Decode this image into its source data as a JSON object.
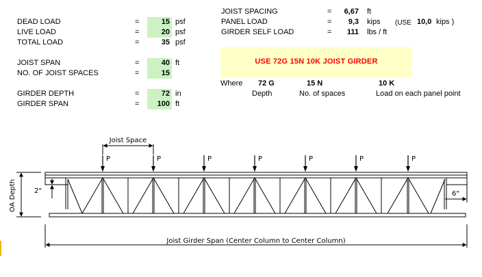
{
  "loads": {
    "dead_label": "DEAD LOAD",
    "dead_eq": "=",
    "dead_value": "15",
    "dead_unit": "psf",
    "live_label": "LIVE LOAD",
    "live_eq": "=",
    "live_value": "20",
    "live_unit": "psf",
    "total_label": "TOTAL LOAD",
    "total_eq": "=",
    "total_value": "35",
    "total_unit": "psf"
  },
  "joist": {
    "span_label": "JOIST SPAN",
    "span_eq": "=",
    "span_value": "40",
    "span_unit": "ft",
    "spaces_label": "NO. OF JOIST SPACES",
    "spaces_eq": "=",
    "spaces_value": "15"
  },
  "girder": {
    "depth_label": "GIRDER DEPTH",
    "depth_eq": "=",
    "depth_value": "72",
    "depth_unit": "in",
    "span_label": "GIRDER SPAN",
    "span_eq": "=",
    "span_value": "100",
    "span_unit": "ft"
  },
  "results": {
    "spacing_label": "JOIST SPACING",
    "spacing_eq": "=",
    "spacing_value": "6,67",
    "spacing_unit": "ft",
    "panel_label": "PANEL LOAD",
    "panel_eq": "=",
    "panel_value": "9,3",
    "panel_unit": "kips",
    "use_prefix": "(USE",
    "use_value": "10,0",
    "use_unit": "kips )",
    "self_label": "GIRDER SELF LOAD",
    "self_eq": "=",
    "self_value": "111",
    "self_unit": "lbs / ft"
  },
  "designation": {
    "use_text": "USE   72G 15N 10K   JOIST GIRDER",
    "where_label": "Where",
    "depth_code": "72 G",
    "spaces_code": "15 N",
    "load_code": "10 K",
    "depth_caption": "Depth",
    "spaces_caption": "No. of spaces",
    "load_caption": "Load on each panel point"
  },
  "diagram": {
    "joist_space_label": "Joist Space",
    "load_label": "P",
    "oa_depth_label": "OA Depth",
    "seat_depth_label": "2\"",
    "bearing_label": "6\"",
    "span_label": "Joist Girder Span (Center Column to Center Column)"
  },
  "colors": {
    "input_bg": "#ccf2c4",
    "note_bg": "#ffffc8",
    "note_text": "#ff0000"
  }
}
